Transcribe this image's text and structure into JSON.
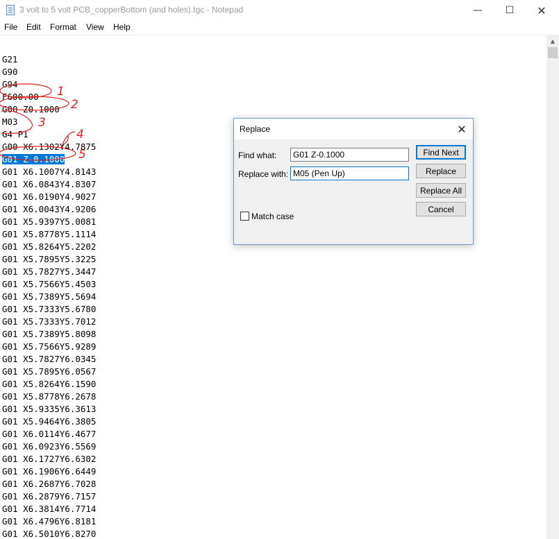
{
  "window": {
    "title": "3 volt to 5 volt PCB_copperBottom (and holes).tgc - Notepad",
    "minimize_glyph": "—",
    "maximize_glyph": "☐",
    "close_glyph": "✕"
  },
  "menu": [
    "File",
    "Edit",
    "Format",
    "View",
    "Help"
  ],
  "editor": {
    "lines": [
      "",
      "G21",
      "G90",
      "G94",
      "F600.00",
      "G00 Z0.1000",
      "M03",
      "G4 P1",
      "G00 X6.1302Y4.7875",
      "G01 Z-0.1000",
      "G01 X6.1007Y4.8143",
      "G01 X6.0843Y4.8307",
      "G01 X6.0190Y4.9027",
      "G01 X6.0043Y4.9206",
      "G01 X5.9397Y5.0081",
      "G01 X5.8778Y5.1114",
      "G01 X5.8264Y5.2202",
      "G01 X5.7895Y5.3225",
      "G01 X5.7827Y5.3447",
      "G01 X5.7566Y5.4503",
      "G01 X5.7389Y5.5694",
      "G01 X5.7333Y5.6780",
      "G01 X5.7333Y5.7012",
      "G01 X5.7389Y5.8098",
      "G01 X5.7566Y5.9289",
      "G01 X5.7827Y6.0345",
      "G01 X5.7895Y6.0567",
      "G01 X5.8264Y6.1590",
      "G01 X5.8778Y6.2678",
      "G01 X5.9335Y6.3613",
      "G01 X5.9464Y6.3805",
      "G01 X6.0114Y6.4677",
      "G01 X6.0923Y6.5569",
      "G01 X6.1727Y6.6302",
      "G01 X6.1906Y6.6449",
      "G01 X6.2687Y6.7028",
      "G01 X6.2879Y6.7157",
      "G01 X6.3814Y6.7714",
      "G01 X6.4796Y6.8181",
      "G01 X6.5010Y6.8270"
    ],
    "selected_line_index": 9
  },
  "annotations": [
    "1",
    "2",
    "3",
    "4",
    "5"
  ],
  "annotation_color": "#e0201c",
  "dialog": {
    "title": "Replace",
    "close_glyph": "✕",
    "find_label": "Find what:",
    "find_value": "G01 Z-0.1000",
    "replace_label": "Replace with:",
    "replace_value": "M05 (Pen Up)",
    "buttons": {
      "find_next": "Find Next",
      "replace": "Replace",
      "replace_all": "Replace All",
      "cancel": "Cancel"
    },
    "match_case_label": "Match case",
    "match_case_checked": false
  },
  "colors": {
    "selection": "#0078d7",
    "dialog_bg": "#f0f0f0",
    "title_text": "#9a9a9a"
  }
}
